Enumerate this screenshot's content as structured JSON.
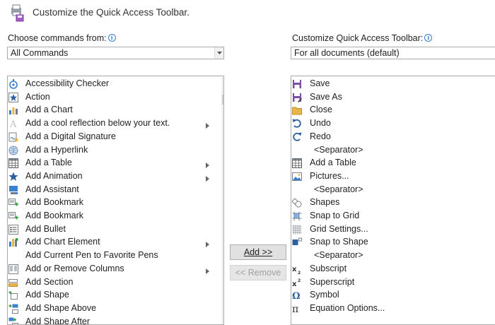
{
  "header": {
    "title": "Customize the Quick Access Toolbar."
  },
  "left": {
    "label": "Choose commands from:",
    "selected": "All Commands",
    "items": [
      {
        "label": "Accessibility Checker",
        "icon": "accessibility-checker-icon",
        "submenu": false
      },
      {
        "label": "Action",
        "icon": "action-star-icon",
        "submenu": false
      },
      {
        "label": "Add a Chart",
        "icon": "chart-icon",
        "submenu": false
      },
      {
        "label": "Add a cool reflection below your text.",
        "icon": "text-effect-icon",
        "submenu": true
      },
      {
        "label": "Add a Digital Signature",
        "icon": "digital-signature-icon",
        "submenu": false
      },
      {
        "label": "Add a Hyperlink",
        "icon": "hyperlink-icon",
        "submenu": false
      },
      {
        "label": "Add a Table",
        "icon": "table-icon",
        "submenu": true
      },
      {
        "label": "Add Animation",
        "icon": "animation-star-icon",
        "submenu": true
      },
      {
        "label": "Add Assistant",
        "icon": "assistant-icon",
        "submenu": false
      },
      {
        "label": "Add Bookmark",
        "icon": "bookmark-icon",
        "submenu": false
      },
      {
        "label": "Add Bookmark",
        "icon": "bookmark-icon",
        "submenu": false
      },
      {
        "label": "Add Bullet",
        "icon": "bullet-icon",
        "submenu": false
      },
      {
        "label": "Add Chart Element",
        "icon": "chart-element-icon",
        "submenu": true
      },
      {
        "label": "Add Current Pen to Favorite Pens",
        "icon": "",
        "submenu": false
      },
      {
        "label": "Add or Remove Columns",
        "icon": "columns-icon",
        "submenu": true
      },
      {
        "label": "Add Section",
        "icon": "section-icon",
        "submenu": false
      },
      {
        "label": "Add Shape",
        "icon": "shape-icon",
        "submenu": false
      },
      {
        "label": "Add Shape Above",
        "icon": "shape-above-icon",
        "submenu": false
      },
      {
        "label": "Add Shape After",
        "icon": "shape-after-icon",
        "submenu": false
      }
    ]
  },
  "right": {
    "label": "Customize Quick Access Toolbar:",
    "selected": "For all documents (default)",
    "items": [
      {
        "label": "Save",
        "icon": "save-icon",
        "separator": false
      },
      {
        "label": "Save As",
        "icon": "save-as-icon",
        "separator": false
      },
      {
        "label": "Close",
        "icon": "folder-icon",
        "separator": false
      },
      {
        "label": "Undo",
        "icon": "undo-icon",
        "separator": false
      },
      {
        "label": "Redo",
        "icon": "redo-icon",
        "separator": false
      },
      {
        "label": "<Separator>",
        "icon": "",
        "separator": true
      },
      {
        "label": "Add a Table",
        "icon": "table-icon",
        "separator": false
      },
      {
        "label": "Pictures...",
        "icon": "pictures-icon",
        "separator": false
      },
      {
        "label": "<Separator>",
        "icon": "",
        "separator": true
      },
      {
        "label": "Shapes",
        "icon": "shapes-icon",
        "separator": false
      },
      {
        "label": "Snap to Grid",
        "icon": "snap-grid-icon",
        "separator": false
      },
      {
        "label": "Grid Settings...",
        "icon": "grid-settings-icon",
        "separator": false
      },
      {
        "label": "Snap to Shape",
        "icon": "snap-shape-icon",
        "separator": false
      },
      {
        "label": "<Separator>",
        "icon": "",
        "separator": true
      },
      {
        "label": "Subscript",
        "icon": "subscript-icon",
        "separator": false
      },
      {
        "label": "Superscript",
        "icon": "superscript-icon",
        "separator": false
      },
      {
        "label": "Symbol",
        "icon": "omega-icon",
        "separator": false
      },
      {
        "label": "Equation Options...",
        "icon": "pi-icon",
        "separator": false
      }
    ]
  },
  "buttons": {
    "add_label": "Add >>",
    "remove_label": "<< Remove"
  },
  "colors": {
    "save": "#7a4fa8",
    "accent": "#3a7fd0",
    "undo": "#2c5f9e",
    "folder": "#e8b54a"
  }
}
